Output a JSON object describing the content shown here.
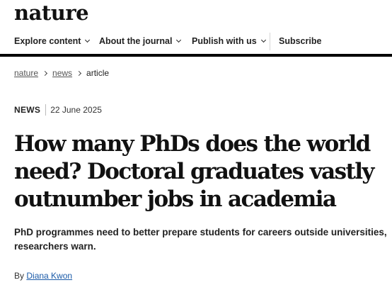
{
  "header": {
    "logo": "nature"
  },
  "nav": {
    "items": [
      {
        "label": "Explore content"
      },
      {
        "label": "About the journal"
      },
      {
        "label": "Publish with us"
      }
    ],
    "subscribe": "Subscribe"
  },
  "breadcrumb": [
    "nature",
    "news",
    "article"
  ],
  "article": {
    "type": "NEWS",
    "date": "22 June 2025",
    "title": "How many PhDs does the world need? Doctoral graduates vastly outnumber jobs in academia",
    "standfirst": "PhD programmes need to better prepare students for careers outside universities, researchers warn.",
    "byline_prefix": "By",
    "author": "Diana Kwon"
  },
  "colors": {
    "link": "#1a5aa8",
    "text": "#222222",
    "rule": "#000000"
  }
}
